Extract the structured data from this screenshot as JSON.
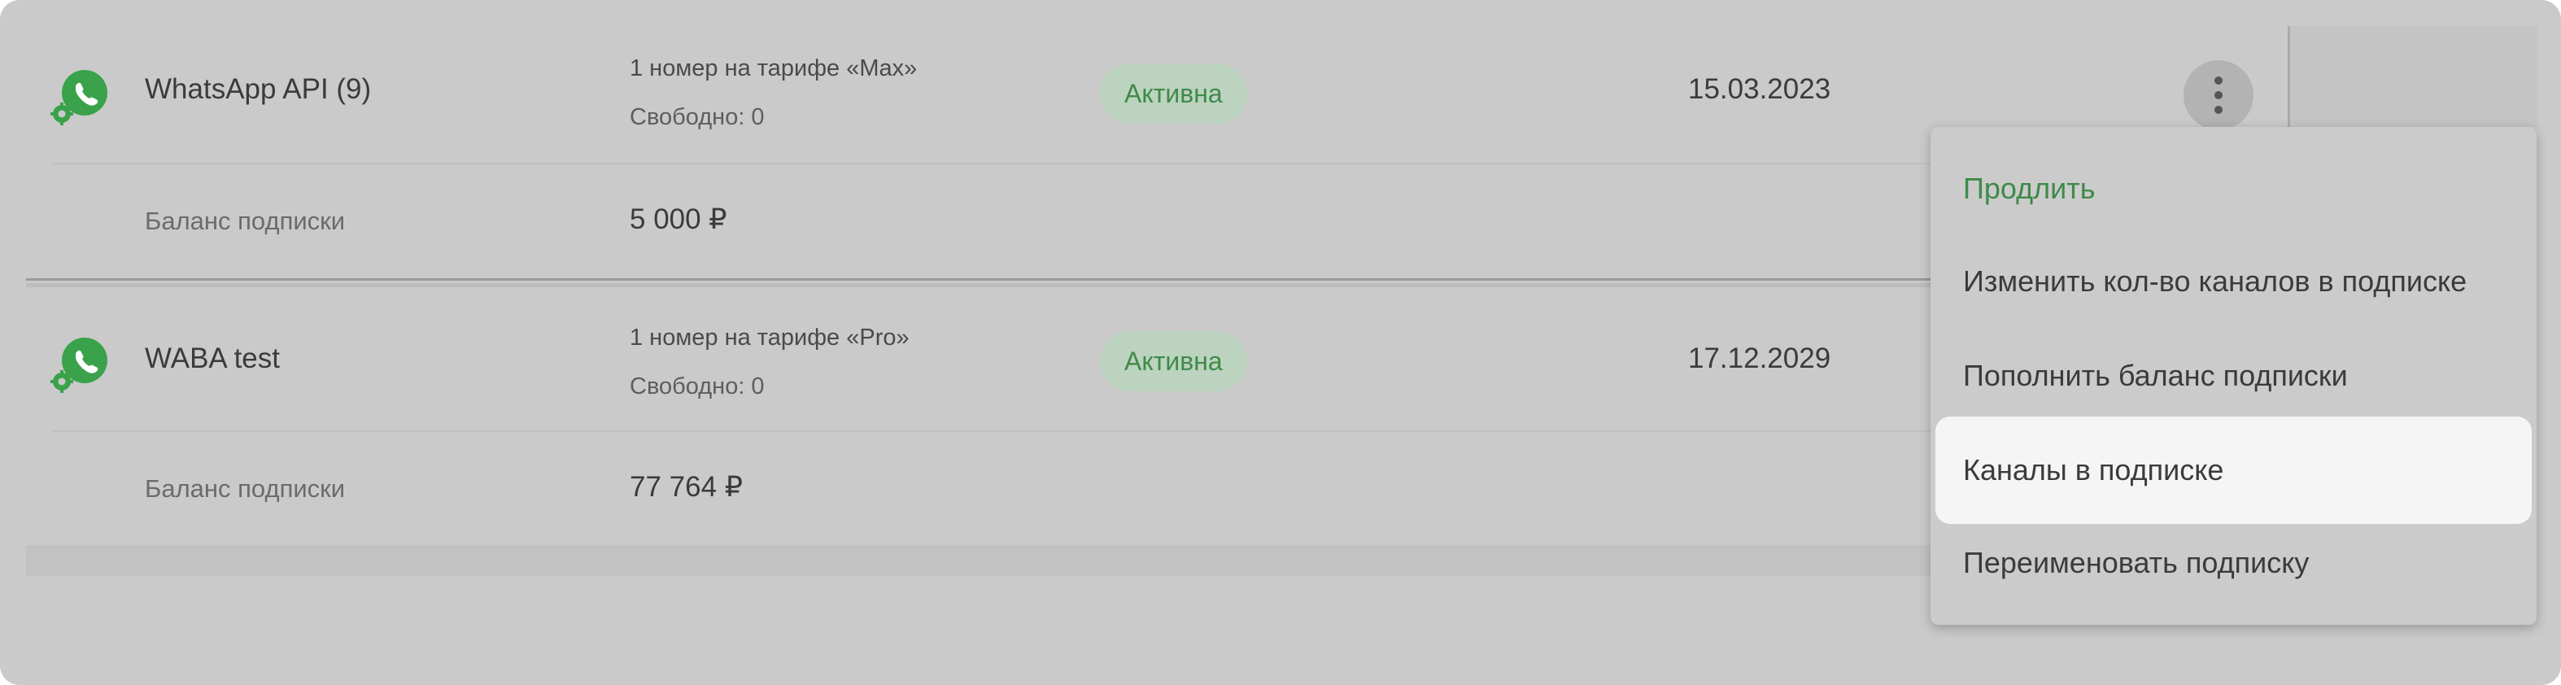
{
  "subscriptions": [
    {
      "name": "WhatsApp API (9)",
      "tariff": "1 номер на тарифе «Max»",
      "free": "Свободно: 0",
      "status": "Активна",
      "date": "15.03.2023",
      "balance_label": "Баланс подписки",
      "balance_value": "5 000 ₽",
      "icon": "whatsapp-settings-icon"
    },
    {
      "name": "WABA test",
      "tariff": "1 номер на тарифе «Pro»",
      "free": "Свободно: 0",
      "status": "Активна",
      "date": "17.12.2029",
      "balance_label": "Баланс подписки",
      "balance_value": "77 764 ₽",
      "icon": "whatsapp-settings-icon"
    }
  ],
  "menu": {
    "items": [
      {
        "label": "Продлить",
        "accent": true
      },
      {
        "label": "Изменить кол-во каналов в подписке"
      },
      {
        "label": "Пополнить баланс подписки"
      },
      {
        "label": "Каналы в подписке",
        "highlighted": true
      },
      {
        "label": "Переименовать подписку"
      }
    ]
  },
  "colors": {
    "accent_green": "#3f8a49",
    "status_bg": "#bcd3bf",
    "icon_green": "#3aa24a",
    "overlay_bg": "#cacaca",
    "menu_highlight": "#f5f5f5"
  }
}
